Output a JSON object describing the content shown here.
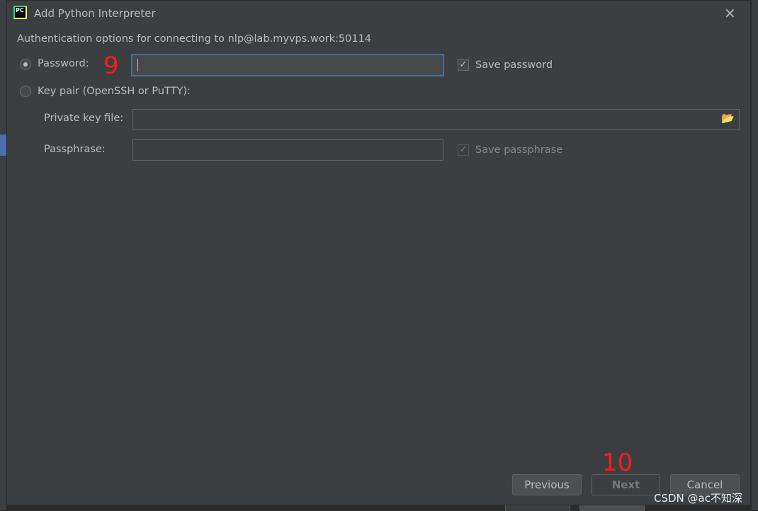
{
  "dialog": {
    "title": "Add Python Interpreter",
    "header": "Authentication options for connecting to nlp@lab.myvps.work:50114",
    "password_label": "Password:",
    "password_value": "",
    "save_password_label": "Save password",
    "save_password_checked": true,
    "keypair_label": "Key pair (OpenSSH or PuTTY):",
    "private_key_label": "Private key file:",
    "private_key_value": "",
    "passphrase_label": "Passphrase:",
    "passphrase_value": "",
    "save_passphrase_label": "Save passphrase",
    "save_passphrase_checked": true,
    "selected_auth": "password",
    "buttons": {
      "previous": "Previous",
      "next": "Next",
      "cancel": "Cancel"
    }
  },
  "annotations": {
    "step9": "9",
    "step10": "10"
  },
  "watermark": "CSDN @ac不知深",
  "colors": {
    "background": "#3c3f41",
    "focus_border": "#466d94",
    "annotation": "#ff1a1a"
  }
}
